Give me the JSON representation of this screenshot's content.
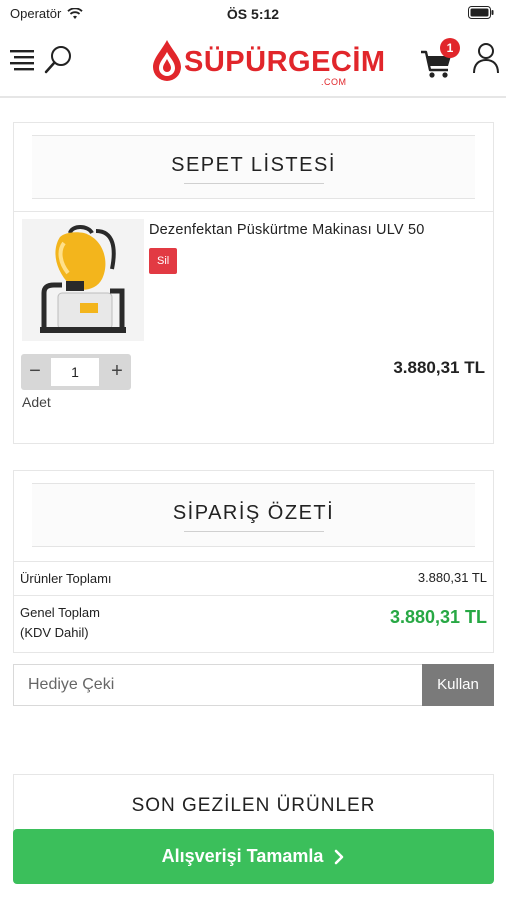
{
  "status_bar": {
    "carrier": "Operatör",
    "time": "ÖS 5:12"
  },
  "header": {
    "brand": "SÜPÜRGECİM",
    "brand_suffix": ".COM",
    "cart_count": "1",
    "brand_color": "#e1262b"
  },
  "cart_section": {
    "title": "SEPET LİSTESİ",
    "item": {
      "name": "Dezenfektan Püskürtme Makinası ULV 50",
      "remove_label": "Sil",
      "quantity": "1",
      "quantity_label": "Adet",
      "minus": "−",
      "plus": "+",
      "price": "3.880,31 TL"
    }
  },
  "summary_section": {
    "title": "SİPARİŞ ÖZETİ",
    "products_total_label": "Ürünler Toplamı",
    "products_total_value": "3.880,31 TL",
    "grand_total_label_line1": "Genel Toplam",
    "grand_total_label_line2": "(KDV Dahil)",
    "grand_total_value": "3.880,31 TL",
    "accent_color": "#27a844"
  },
  "coupon": {
    "placeholder": "Hediye Çeki",
    "button_label": "Kullan"
  },
  "recent_section": {
    "title": "SON GEZİLEN ÜRÜNLER"
  },
  "checkout": {
    "label": "Alışverişi Tamamla",
    "arrow": "›",
    "color": "#3bbf5b"
  }
}
